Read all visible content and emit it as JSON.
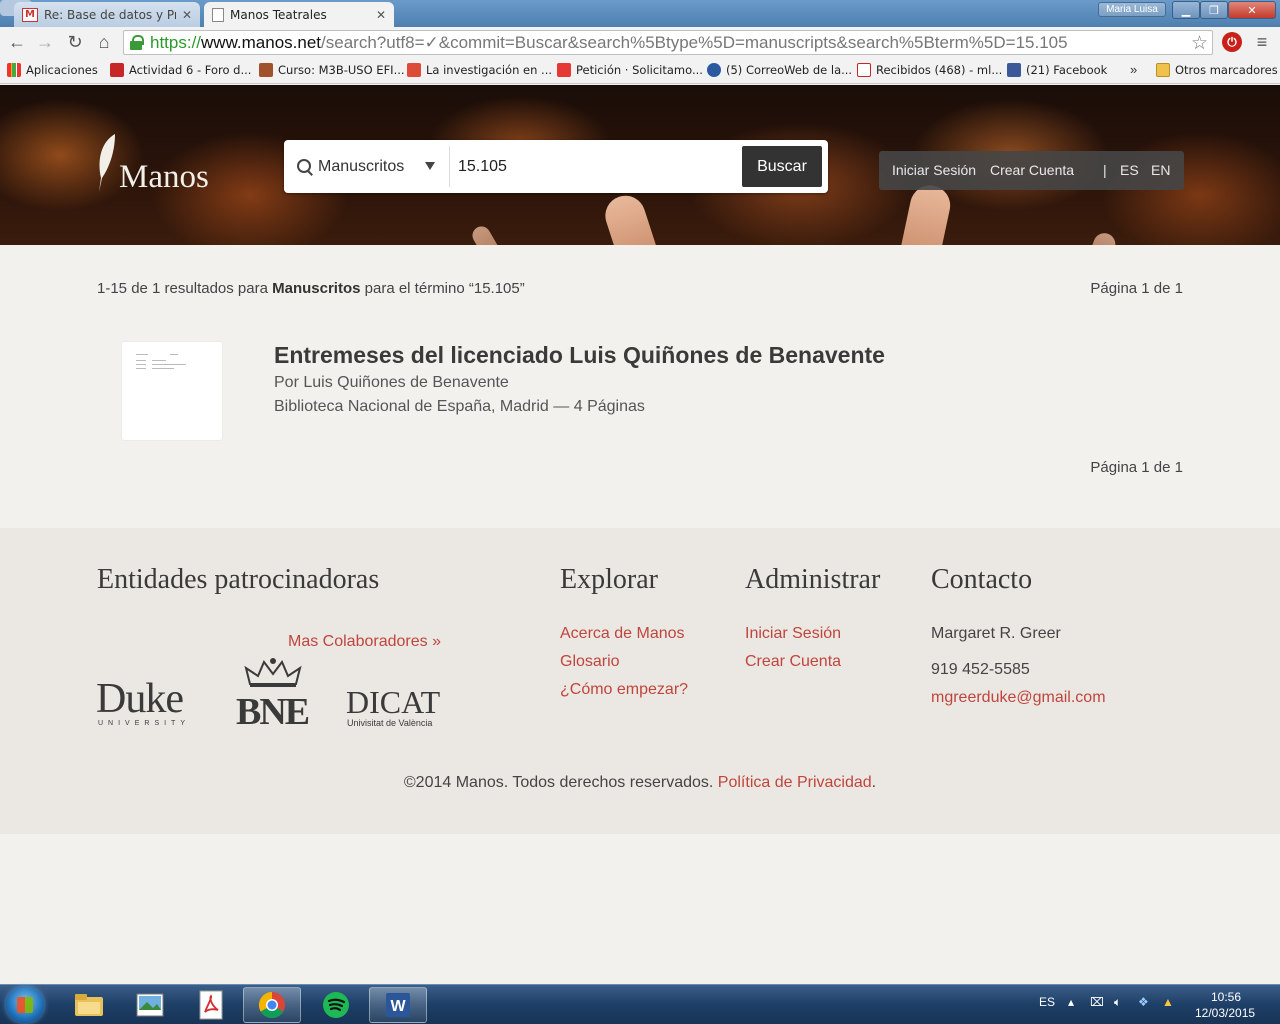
{
  "browser": {
    "tabs": [
      {
        "label": "Re: Base de datos y Prime",
        "favicon": "gmail-icon"
      },
      {
        "label": "Manos Teatrales",
        "favicon": "page-icon"
      }
    ],
    "user": "Maria Luisa",
    "url": {
      "scheme": "https://",
      "host": "www.manos.net",
      "rest": "/search?utf8=✓&commit=Buscar&search%5Btype%5D=manuscripts&search%5Bterm%5D=15.105"
    },
    "bookmarks": [
      {
        "label": "Aplicaciones",
        "color": "#4285f4"
      },
      {
        "label": "Actividad 6 - Foro d...",
        "color": "#c62828"
      },
      {
        "label": "Curso: M3B-USO EFI...",
        "color": "#a0522d"
      },
      {
        "label": "La investigación en ...",
        "color": "#dd4b39"
      },
      {
        "label": "Petición · Solicitamo...",
        "color": "#e53935"
      },
      {
        "label": "(5) CorreoWeb de la...",
        "color": "#2c5aa0"
      },
      {
        "label": "Recibidos (468) - ml...",
        "color": "#c62828"
      },
      {
        "label": "(21) Facebook",
        "color": "#3b5998"
      }
    ],
    "bookmarks_more": "»",
    "other_bookmarks": "Otros marcadores"
  },
  "header": {
    "logo_text": "Manos",
    "search_type": "Manuscritos",
    "search_term": "15.105",
    "search_button": "Buscar",
    "login": "Iniciar Sesión",
    "register": "Crear Cuenta",
    "separator": "|",
    "lang_es": "ES",
    "lang_en": "EN"
  },
  "results": {
    "summary_prefix": "1-15 de 1 resultados para ",
    "summary_type": "Manuscritos",
    "summary_suffix": " para el término “15.105”",
    "page_info": "Página 1 de 1",
    "items": [
      {
        "title": "Entremeses del licenciado Luis Quiñones de Benavente",
        "author": "Por Luis Quiñones de Benavente",
        "holding": "Biblioteca Nacional de España, Madrid — 4 Páginas"
      }
    ]
  },
  "footer": {
    "sponsors_heading": "Entidades patrocinadoras",
    "more_sponsors": "Mas Colaboradores »",
    "sponsor_duke": "Duke",
    "sponsor_duke_sub": "UNIVERSITY",
    "sponsor_bne": "BNE",
    "sponsor_dicat": "DICAT",
    "sponsor_dicat_sub": "Univisitat de València",
    "explore_heading": "Explorar",
    "explore_links": [
      "Acerca de Manos",
      "Glosario",
      "¿Cómo empezar?"
    ],
    "admin_heading": "Administrar",
    "admin_links": [
      "Iniciar Sesión",
      "Crear Cuenta"
    ],
    "contact_heading": "Contacto",
    "contact_name": "Margaret R. Greer",
    "contact_phone": "919 452-5585",
    "contact_email": "mgreerduke@gmail.com",
    "copyright": "©2014 Manos. Todos derechos reservados. ",
    "privacy": "Política de Privacidad",
    "privacy_end": "."
  },
  "taskbar": {
    "lang": "ES",
    "time": "10:56",
    "date": "12/03/2015"
  }
}
